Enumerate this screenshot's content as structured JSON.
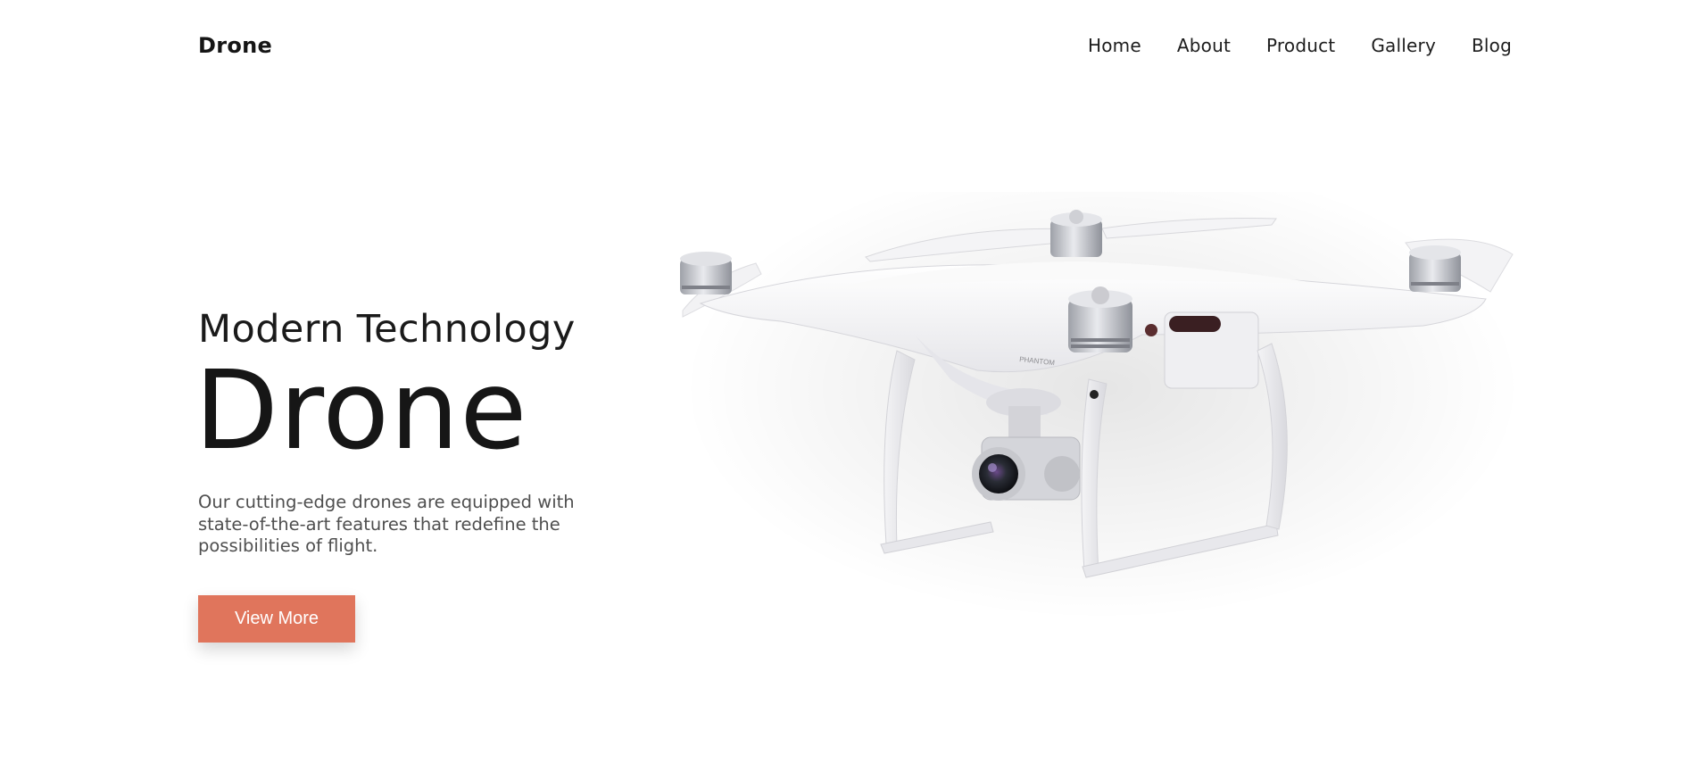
{
  "header": {
    "logo": "Drone",
    "nav": [
      {
        "label": "Home"
      },
      {
        "label": "About"
      },
      {
        "label": "Product"
      },
      {
        "label": "Gallery"
      },
      {
        "label": "Blog"
      }
    ]
  },
  "hero": {
    "subtitle": "Modern Technology",
    "title": "Drone",
    "description": "Our cutting-edge drones are equipped with state-of-the-art features that redefine the possibilities of flight.",
    "cta_label": "View More"
  },
  "image": {
    "icon": "drone-image",
    "model_text": "PHANTOM"
  },
  "colors": {
    "accent": "#e0755c",
    "text": "#1a1a1a",
    "muted": "#4f4f4f",
    "background": "#ffffff"
  }
}
